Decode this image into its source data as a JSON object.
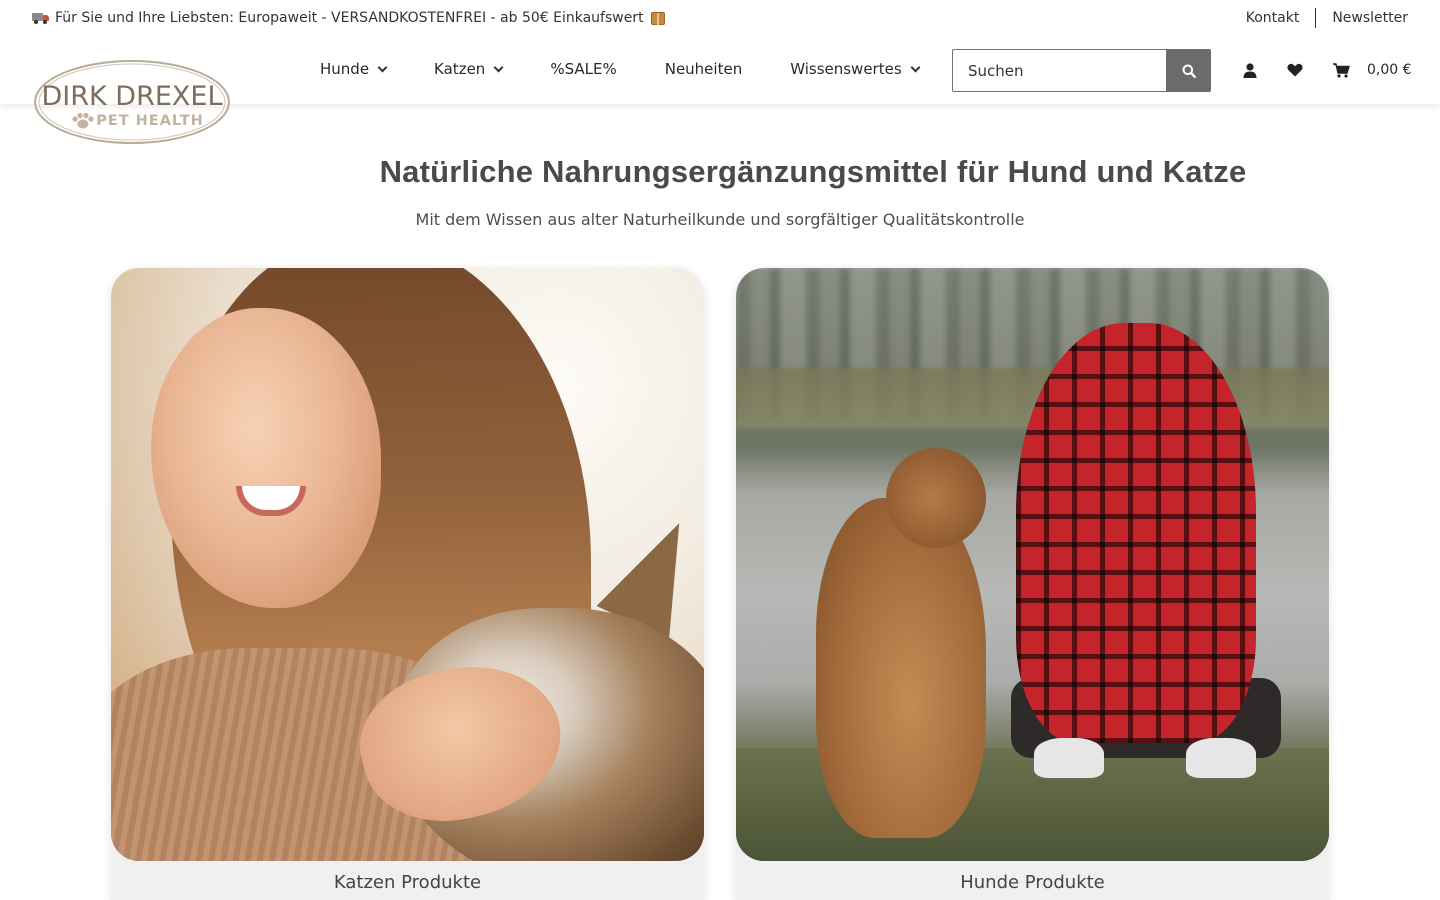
{
  "topbar": {
    "promo_text": "Für Sie und Ihre Liebsten: Europaweit - VERSANDKOSTENFREI - ab 50€ Einkaufswert",
    "links": {
      "kontakt": "Kontakt",
      "newsletter": "Newsletter"
    }
  },
  "logo": {
    "line1": "DIRK DREXEL",
    "line2": "PET HEALTH"
  },
  "nav": {
    "items": [
      {
        "label": "Hunde",
        "has_dropdown": true
      },
      {
        "label": "Katzen",
        "has_dropdown": true
      },
      {
        "label": "%SALE%",
        "has_dropdown": false
      },
      {
        "label": "Neuheiten",
        "has_dropdown": false
      },
      {
        "label": "Wissenswertes",
        "has_dropdown": true
      }
    ]
  },
  "search": {
    "placeholder": "Suchen"
  },
  "header_icons": {
    "account": "user-icon",
    "wishlist": "heart-icon",
    "cart": "cart-icon",
    "cart_total": "0,00 €"
  },
  "hero": {
    "title": "Natürliche Nahrungsergänzungsmittel für Hund und Katze",
    "subtitle": "Mit dem Wissen aus alter Naturheilkunde und sorgfältiger Qualitätskontrolle"
  },
  "cards": [
    {
      "label": "Katzen Produkte"
    },
    {
      "label": "Hunde Produkte"
    }
  ],
  "colors": {
    "accent_gray": "#6b6b6b",
    "logo_brown": "#8c7a66",
    "card_bg": "#f0f0f0"
  }
}
